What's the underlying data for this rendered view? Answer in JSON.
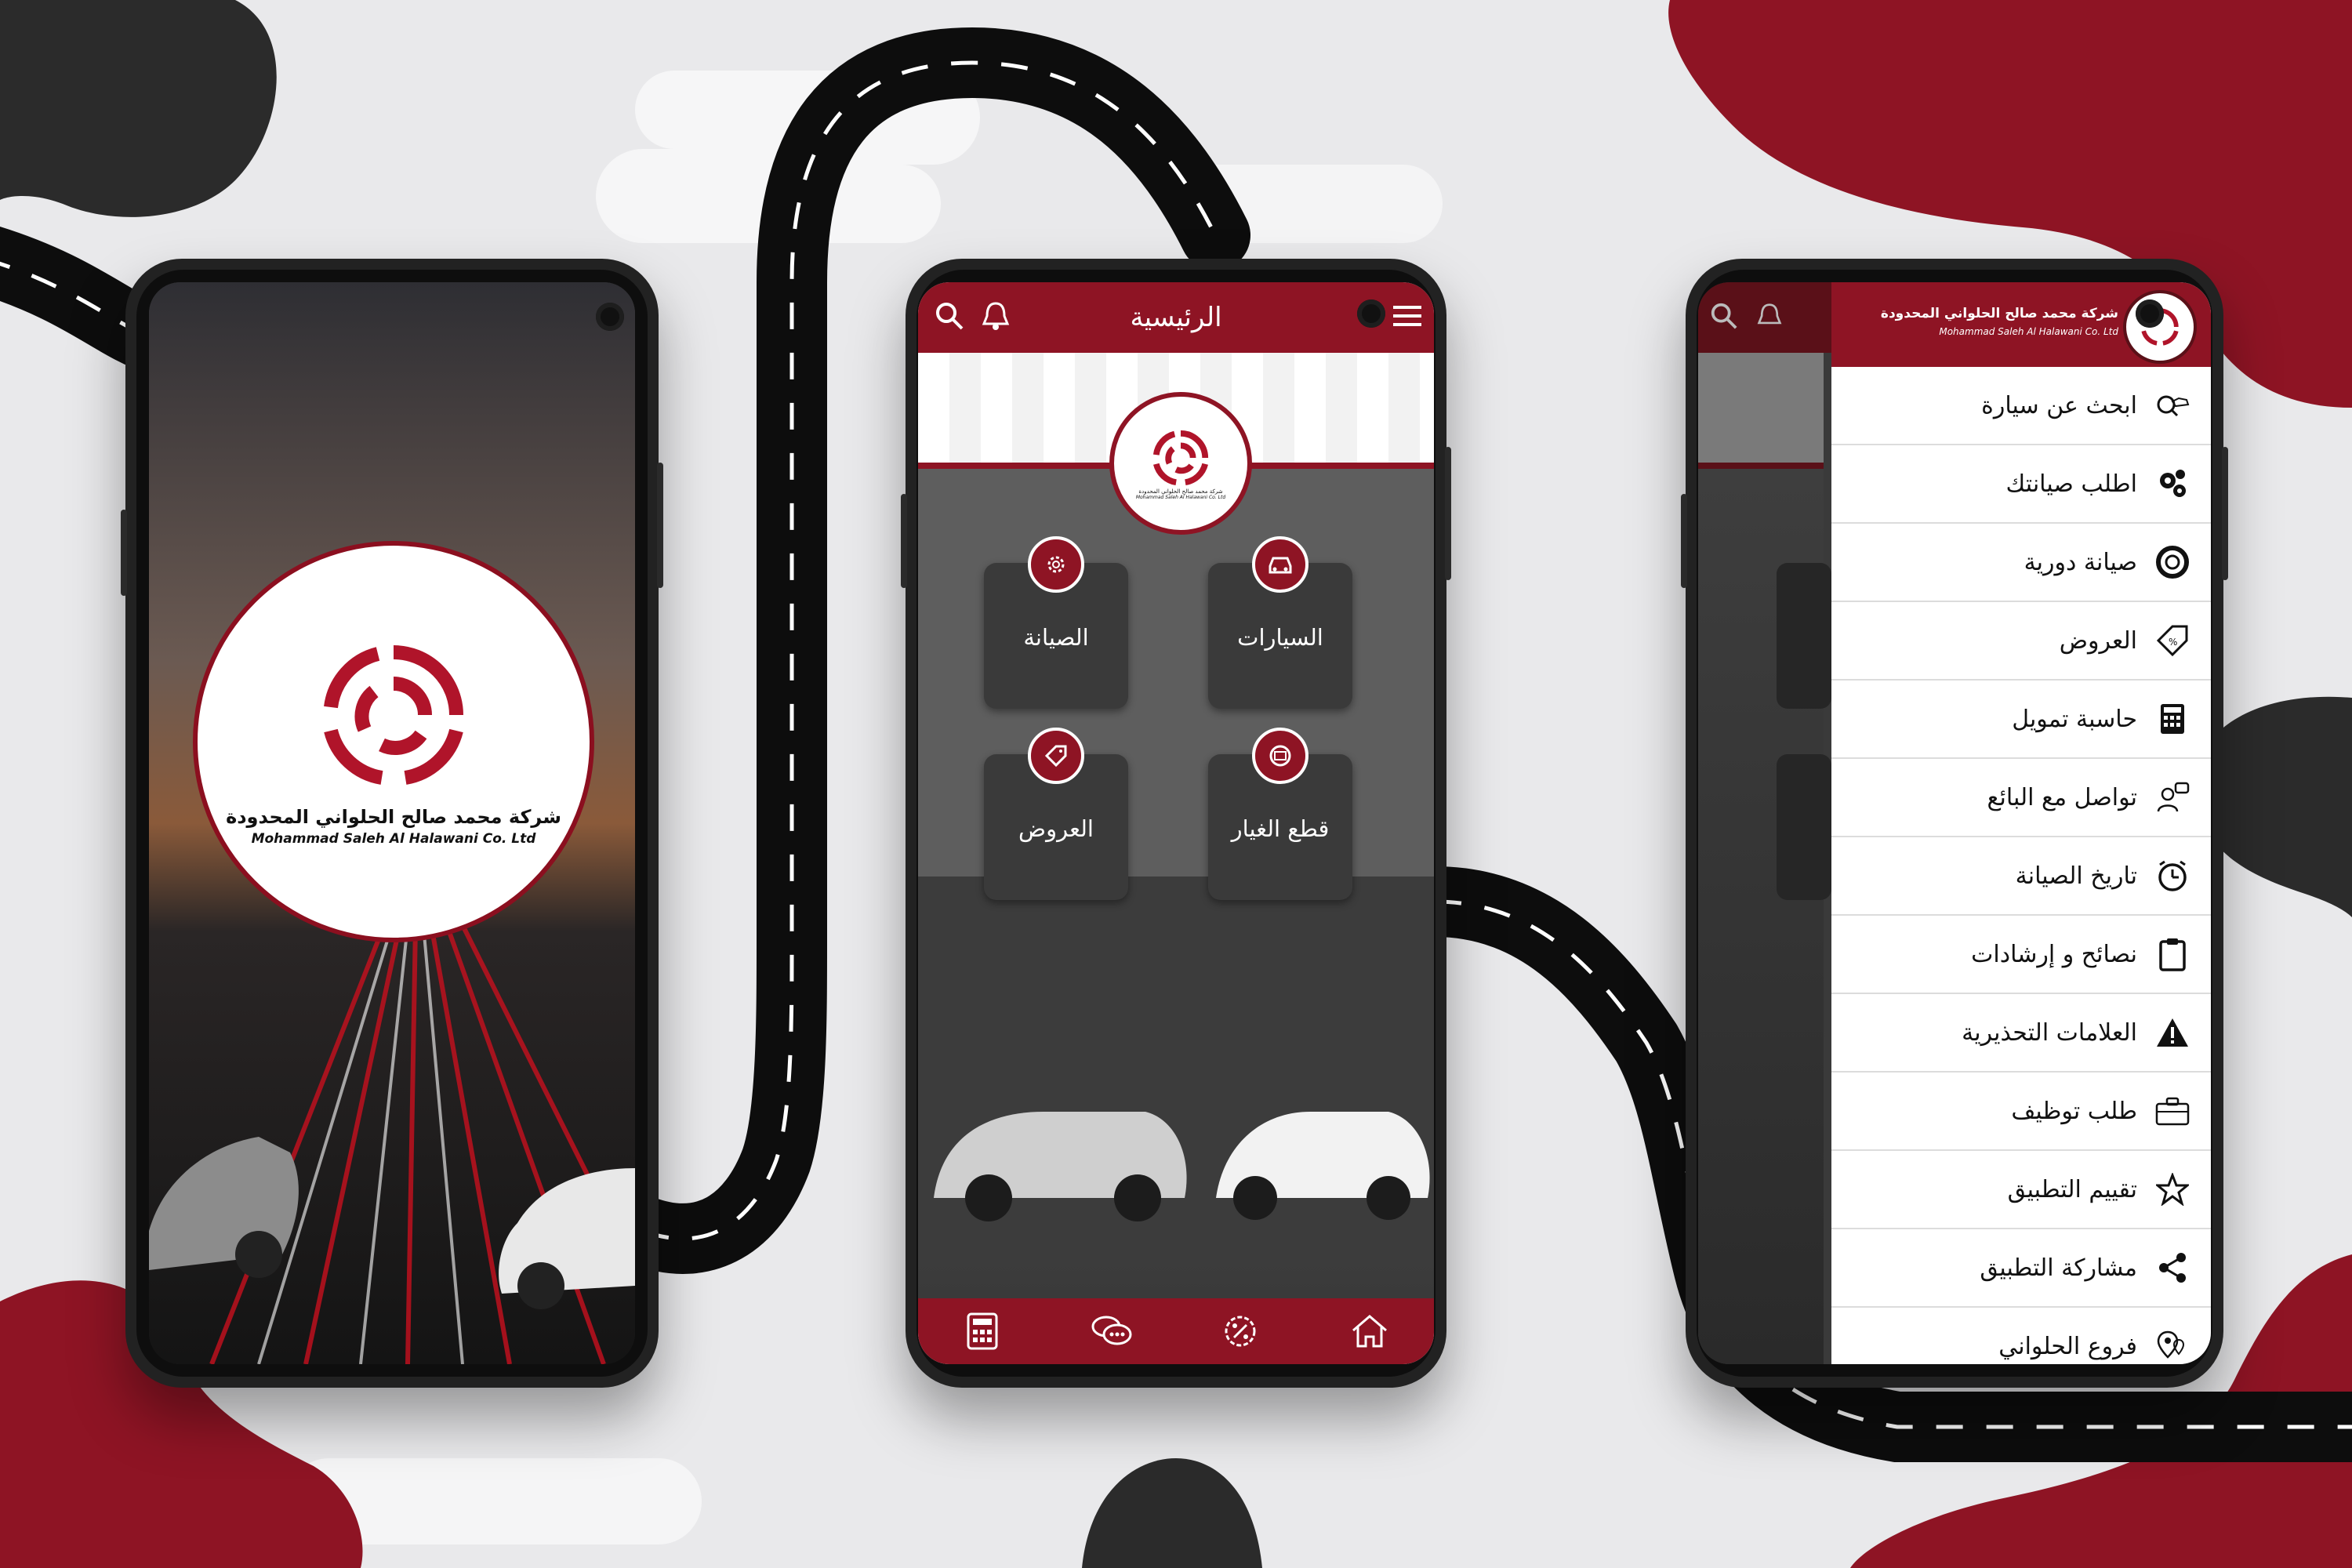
{
  "colors": {
    "brand_red": "#8e1424",
    "dark": "#2b2b2b",
    "background": "#e9e9eb"
  },
  "brand": {
    "name_ar": "شركة محمد صالح الحلواني المحدودة",
    "name_en": "Mohammad Saleh Al Halawani Co. Ltd"
  },
  "home": {
    "title": "الرئيسية",
    "header_icons": [
      "search-icon",
      "bell-icon",
      "menu-icon"
    ],
    "tiles": [
      {
        "label": "السيارات",
        "icon": "car-icon"
      },
      {
        "label": "الصيانة",
        "icon": "maintenance-gear-icon"
      },
      {
        "label": "قطع الغيار",
        "icon": "spare-parts-icon"
      },
      {
        "label": "العروض",
        "icon": "offer-tag-icon"
      }
    ],
    "bottom_nav": [
      "home-icon",
      "percent-offers-icon",
      "chat-icon",
      "calculator-icon"
    ]
  },
  "drawer": {
    "items": [
      {
        "label": "ابحث عن سيارة",
        "icon": "search-car-icon"
      },
      {
        "label": "اطلب صيانتك",
        "icon": "gears-icon"
      },
      {
        "label": "صيانة دورية",
        "icon": "lifebuoy-icon"
      },
      {
        "label": "العروض",
        "icon": "discount-tag-icon"
      },
      {
        "label": "حاسبة تمويل",
        "icon": "calculator-icon"
      },
      {
        "label": "تواصل مع البائع",
        "icon": "seller-chat-icon"
      },
      {
        "label": "تاريخ الصيانة",
        "icon": "alarm-clock-icon"
      },
      {
        "label": "نصائح و إرشادات",
        "icon": "clipboard-icon"
      },
      {
        "label": "العلامات التحذيرية",
        "icon": "warning-icon"
      },
      {
        "label": "طلب توظيف",
        "icon": "briefcase-icon"
      },
      {
        "label": "تقييم التطبيق",
        "icon": "star-icon"
      },
      {
        "label": "مشاركة التطبيق",
        "icon": "share-icon"
      },
      {
        "label": "فروع الحلواني",
        "icon": "location-pin-icon"
      }
    ]
  }
}
